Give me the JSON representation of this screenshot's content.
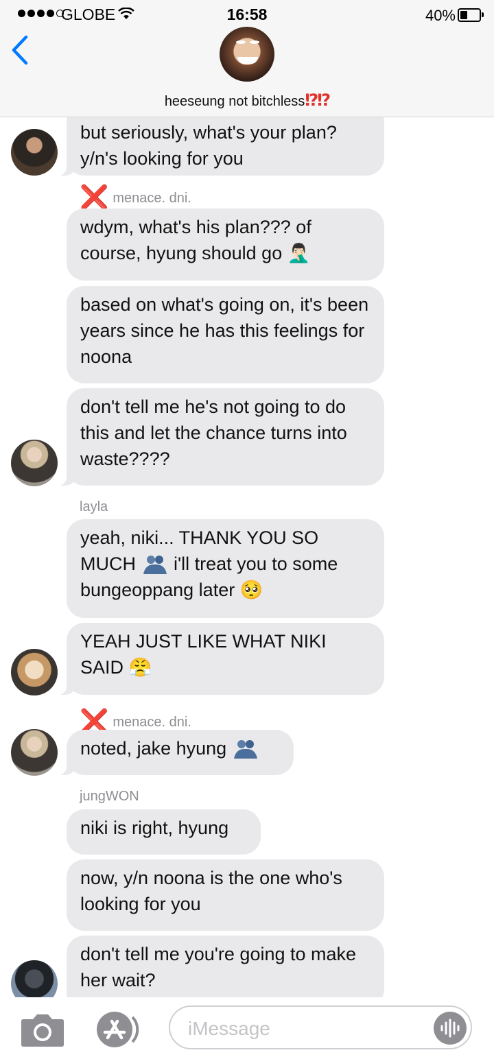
{
  "status_bar": {
    "carrier": "GLOBE",
    "time": "16:58",
    "battery_percent": "40%",
    "battery_level": 0.4,
    "signal_bars": 4
  },
  "header": {
    "group_name": "heeseung not bitchless",
    "group_name_suffix": "⁉⁉",
    "back_icon": "chevron-left-icon"
  },
  "messages": [
    {
      "sender": "",
      "text": "but seriously, what's your plan? y/n's looking for you"
    },
    {
      "sender": "menace. dni.",
      "sender_mark": "❌",
      "text": "wdym, what's his plan??? of course, hyung should go 🤦🏻‍♂️"
    },
    {
      "sender": "",
      "text": "based on what's going on, it's been years since he has this feelings for noona"
    },
    {
      "sender": "",
      "text": "don't tell me he's not going to do this and let the chance turns into waste????"
    },
    {
      "sender": "layla",
      "text_before": "yeah, niki... THANK YOU SO MUCH ",
      "text_after": " i'll treat you to some bungeoppang later 🥺"
    },
    {
      "sender": "",
      "text": "YEAH JUST LIKE WHAT NIKI SAID 😤"
    },
    {
      "sender": "menace. dni.",
      "sender_mark": "❌",
      "text": "noted, jake hyung "
    },
    {
      "sender": "jungWON",
      "text": "niki is right, hyung"
    },
    {
      "sender": "",
      "text": "now, y/n noona is the one who's looking for you"
    },
    {
      "sender": "",
      "text": "don't tell me you're going to make her wait?"
    }
  ],
  "composer": {
    "placeholder": "iMessage",
    "camera_icon": "camera-icon",
    "apps_icon": "app-store-icon",
    "audio_icon": "audio-waveform-icon"
  },
  "colors": {
    "accent": "#007aff",
    "bubble": "#e9e9eb",
    "sender_gray": "#8e8e93",
    "red_mark": "#e0322b"
  }
}
